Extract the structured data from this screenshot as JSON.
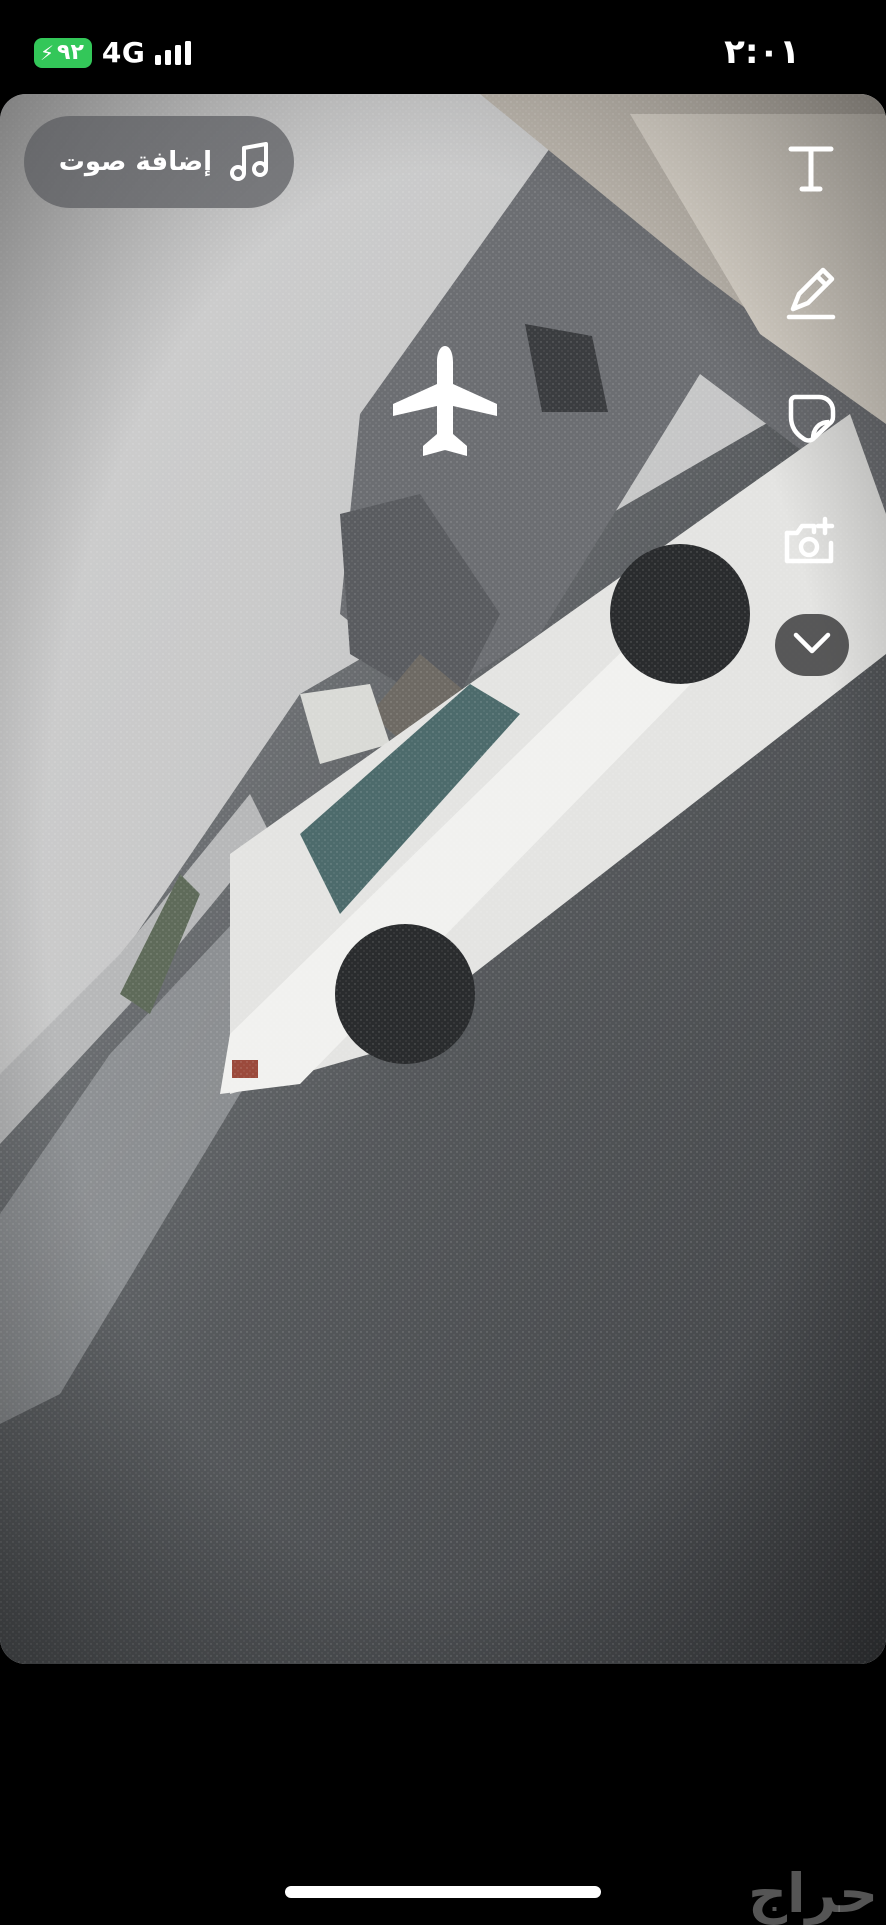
{
  "status_bar": {
    "battery": "٩٢",
    "network": "4G",
    "time": "٢:٠١"
  },
  "story_editor": {
    "add_sound_label": "إضافة صوت",
    "tools": [
      "text-icon",
      "pencil-icon",
      "sticker-icon",
      "camera-flip-icon",
      "chevron-down-icon"
    ],
    "sticker": "airplane-icon"
  },
  "watermark": "حراج",
  "colors": {
    "battery": "#33c759",
    "background": "#000000",
    "pill": "#5a5c5f"
  }
}
